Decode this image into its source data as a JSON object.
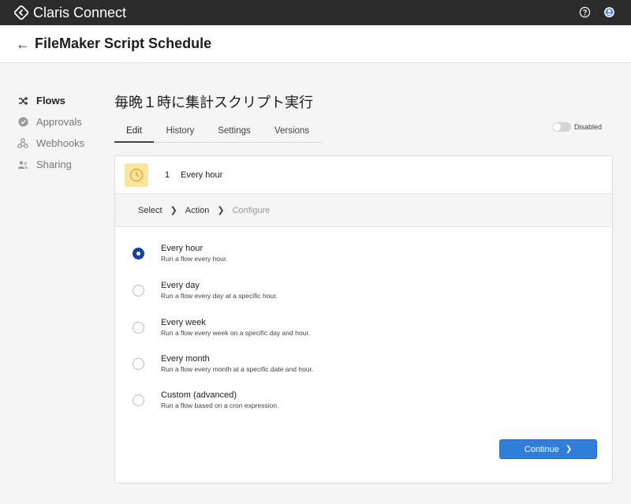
{
  "app": {
    "brand": "Claris Connect",
    "help_icon": "help-circle-icon",
    "account_icon": "account-icon"
  },
  "header": {
    "title": "FileMaker Script Schedule"
  },
  "sidebar": {
    "items": [
      {
        "label": "Flows",
        "icon": "shuffle-icon",
        "active": true
      },
      {
        "label": "Approvals",
        "icon": "check-circle-icon",
        "active": false
      },
      {
        "label": "Webhooks",
        "icon": "webhook-icon",
        "active": false
      },
      {
        "label": "Sharing",
        "icon": "people-icon",
        "active": false
      }
    ]
  },
  "flow": {
    "title": "毎晩１時に集計スクリプト実行",
    "tabs": [
      "Edit",
      "History",
      "Settings",
      "Versions"
    ],
    "active_tab": "Edit",
    "status": "Disabled"
  },
  "step": {
    "number": "1",
    "name": "Every hour",
    "icon": "clock-icon",
    "breadcrumb": [
      "Select",
      "Action",
      "Configure"
    ],
    "options": [
      {
        "label": "Every hour",
        "desc": "Run a flow every hour.",
        "checked": true
      },
      {
        "label": "Every day",
        "desc": "Run a flow every day at a specific hour.",
        "checked": false
      },
      {
        "label": "Every week",
        "desc": "Run a flow every week on a specific day and hour.",
        "checked": false
      },
      {
        "label": "Every month",
        "desc": "Run a flow every month at a specific date and hour.",
        "checked": false
      },
      {
        "label": "Custom (advanced)",
        "desc": "Run a flow based on a cron expression.",
        "checked": false
      }
    ],
    "continue_label": "Continue"
  },
  "colors": {
    "topbar": "#2b2b2b",
    "accent": "#2f7fd8",
    "radio_checked": "#1a3f9c",
    "clock_bg": "#fbe3a0"
  }
}
